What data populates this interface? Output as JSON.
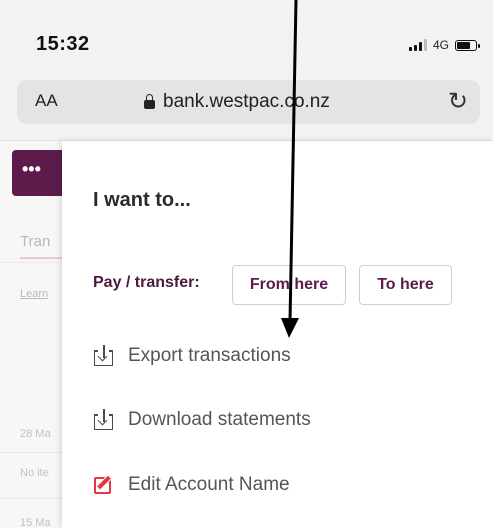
{
  "status_bar": {
    "time": "15:32",
    "network": "4G"
  },
  "browser": {
    "text_size_label": "AA",
    "url": "bank.westpac.co.nz"
  },
  "background_page": {
    "menu_button": "•••",
    "tab_partial": "Tran",
    "link_partial": "Learn",
    "date_1_partial": "28 Ma",
    "no_items_partial": "No ite",
    "date_2_partial": "15 Ma"
  },
  "panel": {
    "title": "I want to...",
    "pay_label": "Pay / transfer:",
    "from_here": "From here",
    "to_here": "To here",
    "actions": [
      {
        "label": "Export transactions",
        "icon": "download-icon"
      },
      {
        "label": "Download statements",
        "icon": "download-icon"
      },
      {
        "label": "Edit Account Name",
        "icon": "edit-icon"
      }
    ]
  },
  "colors": {
    "brand": "#5c1b4a",
    "edit_accent": "#e0383e"
  }
}
